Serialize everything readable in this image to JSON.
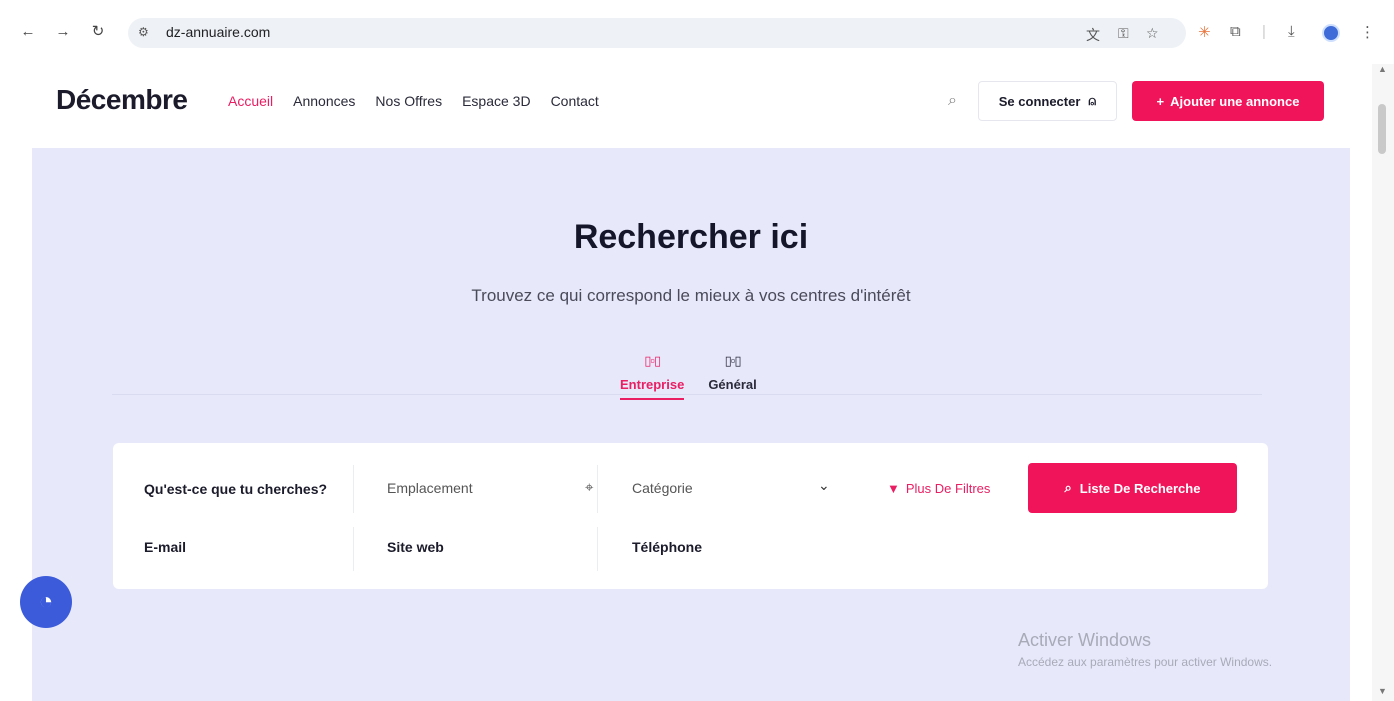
{
  "browser": {
    "url": "dz-annuaire.com",
    "icons": [
      "back-arrow-icon",
      "forward-arrow-icon",
      "reload-icon",
      "site-settings-icon",
      "translate-icon",
      "password-key-icon",
      "bookmark-star-icon",
      "extension-sparkle-icon",
      "extensions-puzzle-icon",
      "download-icon",
      "profile-avatar-icon",
      "menu-kebab-icon"
    ]
  },
  "header": {
    "logo": "Décembre",
    "nav": [
      "Accueil",
      "Annonces",
      "Nos Offres",
      "Espace 3D",
      "Contact"
    ],
    "active_nav": "Accueil",
    "login_label": "Se connecter",
    "add_label": "Ajouter une annonce"
  },
  "hero": {
    "title": "Rechercher ici",
    "subtitle": "Trouvez ce qui correspond le mieux à vos centres d'intérêt",
    "tabs": [
      {
        "label": "Entreprise",
        "active": true
      },
      {
        "label": "Général",
        "active": false
      }
    ]
  },
  "search": {
    "what": "Qu'est-ce que tu cherches?",
    "location": "Emplacement",
    "category": "Catégorie",
    "filters_label": "Plus De Filtres",
    "search_button": "Liste De Recherche",
    "email": "E-mail",
    "website": "Site web",
    "phone": "Téléphone"
  },
  "watermark": {
    "line1": "Activer Windows",
    "line2": "Accédez aux paramètres pour activer Windows."
  },
  "colors": {
    "accent": "#f0145a",
    "hero_bg": "#e7e9fb",
    "cookie": "#3b5bdb"
  }
}
